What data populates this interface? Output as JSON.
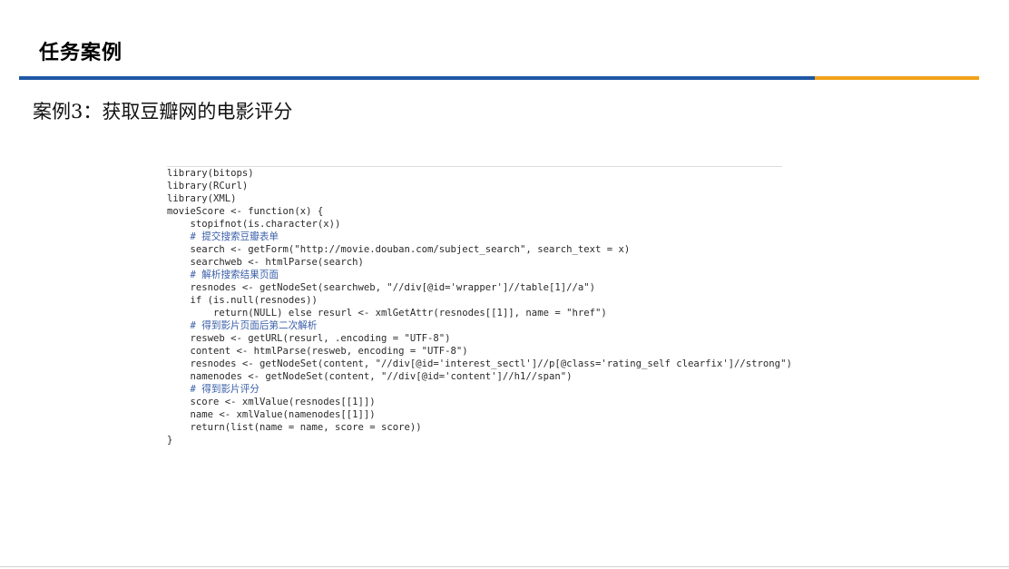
{
  "header": {
    "title": "任务案例"
  },
  "colors": {
    "rule_blue": "#1f57a5",
    "rule_orange": "#f0a21b"
  },
  "subtitle": "案例3：获取豆瓣网的电影评分",
  "code_lines": [
    "library(bitops)",
    "library(RCurl)",
    "library(XML)",
    "movieScore <- function(x) {",
    "    stopifnot(is.character(x))",
    "    # 提交搜索豆瓣表单",
    "    search <- getForm(\"http://movie.douban.com/subject_search\", search_text = x)",
    "    searchweb <- htmlParse(search)",
    "    # 解析搜索结果页面",
    "    resnodes <- getNodeSet(searchweb, \"//div[@id='wrapper']//table[1]//a\")",
    "    if (is.null(resnodes))",
    "        return(NULL) else resurl <- xmlGetAttr(resnodes[[1]], name = \"href\")",
    "    # 得到影片页面后第二次解析",
    "    resweb <- getURL(resurl, .encoding = \"UTF-8\")",
    "    content <- htmlParse(resweb, encoding = \"UTF-8\")",
    "    resnodes <- getNodeSet(content, \"//div[@id='interest_sectl']//p[@class='rating_self clearfix']//strong\")",
    "    namenodes <- getNodeSet(content, \"//div[@id='content']//h1//span\")",
    "    # 得到影片评分",
    "    score <- xmlValue(resnodes[[1]])",
    "    name <- xmlValue(namenodes[[1]])",
    "    return(list(name = name, score = score))",
    "}"
  ]
}
